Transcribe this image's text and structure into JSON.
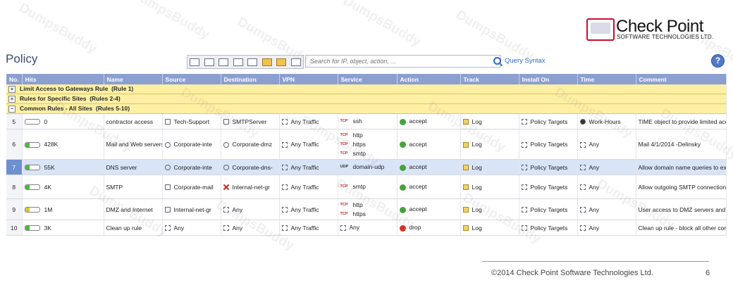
{
  "brand": {
    "name": "Check Point",
    "tagline": "SOFTWARE TECHNOLOGIES LTD."
  },
  "page": {
    "title": "Policy"
  },
  "search": {
    "placeholder": "Search for IP, object, action, ...",
    "query_syntax": "Query Syntax"
  },
  "help_label": "?",
  "watermark": "DumpsBuddy",
  "table": {
    "columns": [
      "No.",
      "Hits",
      "Name",
      "Source",
      "Destination",
      "VPN",
      "Service",
      "Action",
      "Track",
      "Install On",
      "Time",
      "Comment"
    ],
    "sections": [
      {
        "toggle": "+",
        "label": "Limit Access to Gateways Rule",
        "range": "(Rule 1)"
      },
      {
        "toggle": "+",
        "label": "Rules for Specific Sites",
        "range": "(Rules 2-4)"
      },
      {
        "toggle": "−",
        "label": "Common Rules - All Sites",
        "range": "(Rules 5-10)"
      }
    ],
    "rows": [
      {
        "no": "5",
        "hits": "0",
        "hits_fill": 0.0,
        "name": "contractor access",
        "source": "Tech-Support",
        "destination": "SMTPServer",
        "vpn": "Any Traffic",
        "services": [
          {
            "proto": "TCP",
            "name": "ssh"
          }
        ],
        "action": "accept",
        "track": "Log",
        "install_on": "Policy Targets",
        "time": "Work-Hours",
        "comment": "TIME object to provide limited acc for contractor access."
      },
      {
        "no": "6",
        "hits": "428K",
        "hits_fill": 0.3,
        "name": "Mail and Web servers",
        "source": "Corporate-inte",
        "destination": "Corporate-dmz",
        "vpn": "Any Traffic",
        "services": [
          {
            "proto": "TCP",
            "name": "http"
          },
          {
            "proto": "TCP",
            "name": "https"
          },
          {
            "proto": "TCP",
            "name": "smtp"
          }
        ],
        "action": "accept",
        "track": "Log",
        "install_on": "Policy Targets",
        "time": "Any",
        "comment": "Mail 4/1/2014 -Delinsky"
      },
      {
        "no": "7",
        "hits": "55K",
        "hits_fill": 0.3,
        "name": "DNS server",
        "source": "Corporate-inte",
        "destination": "Corporate-dns-",
        "vpn": "Any Traffic",
        "services": [
          {
            "proto": "UDP",
            "name": "domain-udp"
          }
        ],
        "action": "accept",
        "track": "Log",
        "install_on": "Policy Targets",
        "time": "Any",
        "comment": "Allow domain name queries to external DNS server"
      },
      {
        "no": "8",
        "hits": "4K",
        "hits_fill": 0.3,
        "name": "SMTP",
        "source": "Corporate-mail",
        "destination": "Internal-net-gr",
        "vpn": "Any Traffic",
        "services": [
          {
            "proto": "TCP",
            "name": "smtp"
          }
        ],
        "action": "accept",
        "track": "Log",
        "install_on": "Policy Targets",
        "time": "Any",
        "comment": "Allow outgoing SMTP connections but don't allow the mail server to initiate connections to the internal networks, in case it is compromised"
      },
      {
        "no": "9",
        "hits": "1M",
        "hits_fill": 0.3,
        "name": "DMZ and Internet",
        "source": "Internal-net-gr",
        "destination": "Any",
        "vpn": "Any Traffic",
        "services": [
          {
            "proto": "TCP",
            "name": "http"
          },
          {
            "proto": "TCP",
            "name": "https"
          }
        ],
        "action": "accept",
        "track": "Log",
        "install_on": "Policy Targets",
        "time": "Any",
        "comment": "User access to DMZ servers and Internet"
      },
      {
        "no": "10",
        "hits": "3K",
        "hits_fill": 0.3,
        "name": "Clean up rule",
        "source": "Any",
        "destination": "Any",
        "vpn": "Any Traffic",
        "services": [
          {
            "proto": "",
            "name": "Any"
          }
        ],
        "action": "drop",
        "track": "Log",
        "install_on": "Policy Targets",
        "time": "Any",
        "comment": "Clean up rule - block all other connections"
      }
    ]
  },
  "footer": {
    "copyright": "©2014 Check Point Software Technologies Ltd.",
    "page_number": "6"
  }
}
